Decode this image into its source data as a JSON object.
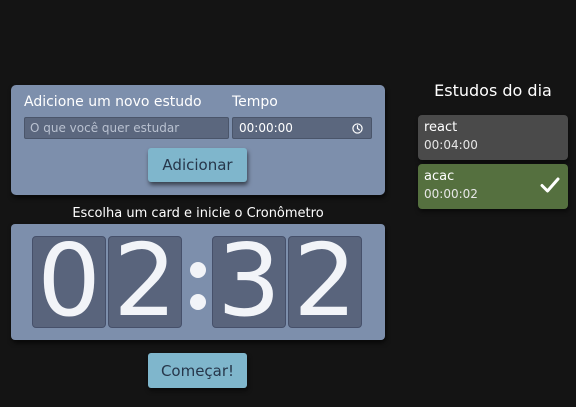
{
  "form": {
    "study_label": "Adicione um novo estudo",
    "study_placeholder": "O que você quer estudar",
    "time_label": "Tempo",
    "time_value": "00:00:00",
    "add_button": "Adicionar"
  },
  "timer": {
    "caption": "Escolha um card e inicie o Cronômetro",
    "digits": [
      "0",
      "2",
      "3",
      "2"
    ],
    "start_button": "Começar!"
  },
  "daily": {
    "title": "Estudos do dia",
    "items": [
      {
        "name": "react",
        "time": "00:04:00",
        "completed": false
      },
      {
        "name": "acac",
        "time": "00:00:02",
        "completed": true
      }
    ]
  },
  "colors": {
    "background": "#141414",
    "card": "#7d8fac",
    "button": "#7fb6cc",
    "digit_bg": "#59647c",
    "item_default": "#4a4a4a",
    "item_completed": "#55703f"
  },
  "icons": {
    "time_input": "clock-icon",
    "completed_item": "check-icon"
  }
}
